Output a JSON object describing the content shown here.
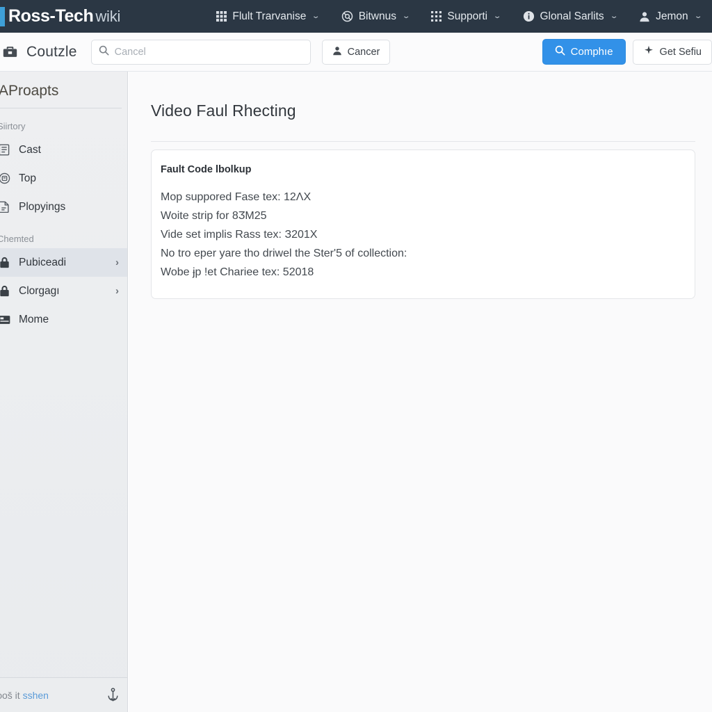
{
  "topnav": {
    "brand_strong": "Ross-Tech",
    "brand_light": "wiki",
    "accent_color": "#3ea0d8",
    "background_color": "#2b3744",
    "items": [
      {
        "label": "Flult Trarvanise",
        "icon": "grid-apps-icon",
        "caret": "⌄"
      },
      {
        "label": "Bitwnus",
        "icon": "lifebuoy-icon",
        "caret": "⌄"
      },
      {
        "label": "Supporti",
        "icon": "grid-dots-icon",
        "caret": "⌄"
      },
      {
        "label": "Glonal Sarlits",
        "icon": "info-circle-icon",
        "caret": "⌄"
      },
      {
        "label": "Jemon",
        "icon": "user-icon",
        "caret": "⌄"
      }
    ]
  },
  "toolbar": {
    "logo_icon": "toolbox-icon",
    "title": "Coutzle",
    "search": {
      "icon": "search-icon",
      "placeholder": "Cancel",
      "value": ""
    },
    "account_button": {
      "label": "Cancer",
      "icon": "user-icon"
    },
    "primary_button": {
      "label": "Comphıe",
      "icon": "search-icon",
      "color": "#3291e8"
    },
    "secondary_button": {
      "label": "Get Sefiu",
      "icon": "sparkle-icon"
    }
  },
  "sidebar": {
    "title": "AProapts",
    "sections": [
      {
        "label": "Siirtory",
        "items": [
          {
            "label": "Cast",
            "icon": "document-list-icon",
            "chevron": "",
            "active": false
          },
          {
            "label": "Top",
            "icon": "badge-circle-icon",
            "chevron": "",
            "active": false
          },
          {
            "label": "Plopyings",
            "icon": "file-page-icon",
            "chevron": "",
            "active": false
          }
        ]
      },
      {
        "label": "Chemted",
        "items": [
          {
            "label": "Pubiceadi",
            "icon": "lock-icon",
            "chevron": "›",
            "active": true
          },
          {
            "label": "Clorgagı",
            "icon": "lock-icon",
            "chevron": "›",
            "active": false
          },
          {
            "label": "Mome",
            "icon": "card-icon",
            "chevron": "",
            "active": false
          }
        ]
      }
    ],
    "footer": {
      "text_prefix": "ɔoš it ",
      "link": "sshen",
      "icon": "anchor-down-icon"
    }
  },
  "main": {
    "page_title": "Video Faul Rhecting",
    "card": {
      "title": "Fault Code lbolkup",
      "lines": [
        "Mop suppored Fase tex: 12ΛX",
        "Woite strip for 8ӠM25",
        "Vide set implis Rass tex: З201X",
        "No tro eper yare tho driwel the Ster'5 of collection:",
        "Wobe ɉp !et Chariee tex: 52018"
      ]
    }
  }
}
